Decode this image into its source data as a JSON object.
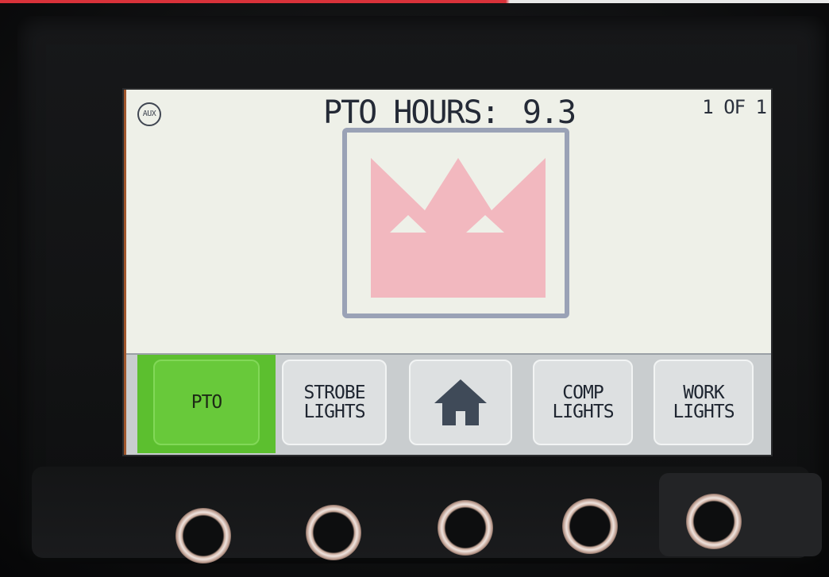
{
  "screen": {
    "aux_label": "AUX",
    "title_label": "PTO HOURS:",
    "title_value": "9.3",
    "page_indicator": "1 OF 1"
  },
  "logo": {
    "icon": "crown-logo-icon",
    "crown_color": "#f2b8bf",
    "frame_color": "#9aa2b6"
  },
  "nav": {
    "buttons": [
      {
        "label": "PTO",
        "active": true
      },
      {
        "label": "STROBE\nLIGHTS",
        "active": false
      },
      {
        "label": "",
        "icon": "home-icon",
        "active": false
      },
      {
        "label": "COMP\nLIGHTS",
        "active": false
      },
      {
        "label": "WORK\nLIGHTS",
        "active": false
      }
    ]
  },
  "colors": {
    "active_green": "#68c93a",
    "screen_bg": "#eef0e8",
    "button_bg": "#dde0e1"
  }
}
